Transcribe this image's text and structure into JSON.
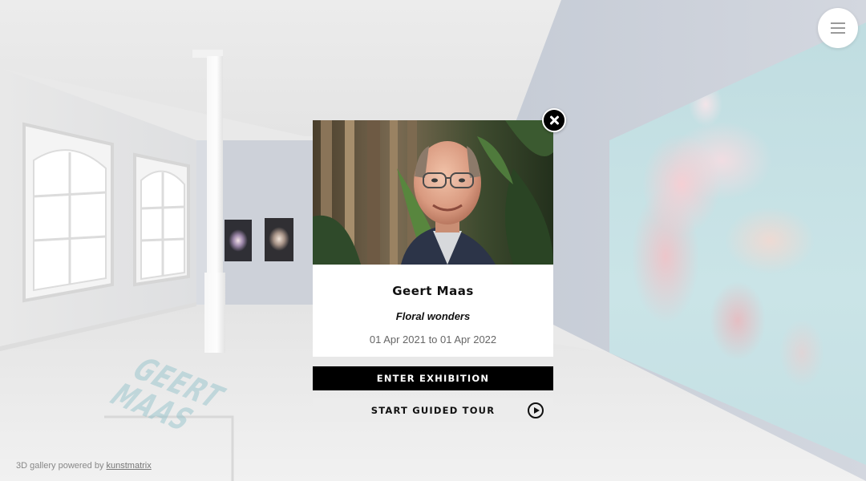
{
  "modal": {
    "artist_name": "Geert Maas",
    "exhibition_title": "Floral wonders",
    "dates": "01 Apr 2021 to 01 Apr 2022",
    "enter_label": "ENTER EXHIBITION",
    "tour_label": "START GUIDED TOUR",
    "close_icon": "close-icon",
    "play_icon": "play-circle-icon"
  },
  "header": {
    "menu_icon": "hamburger-menu-icon"
  },
  "footer": {
    "credit_prefix": "3D gallery powered by",
    "credit_link": "kunstmatrix"
  },
  "floor_text": "GEERT MAAS",
  "colors": {
    "button_primary": "#000000",
    "button_secondary": "#ececec",
    "art_wall": "#c4dfe3",
    "back_wall": "#c8cdd6"
  }
}
